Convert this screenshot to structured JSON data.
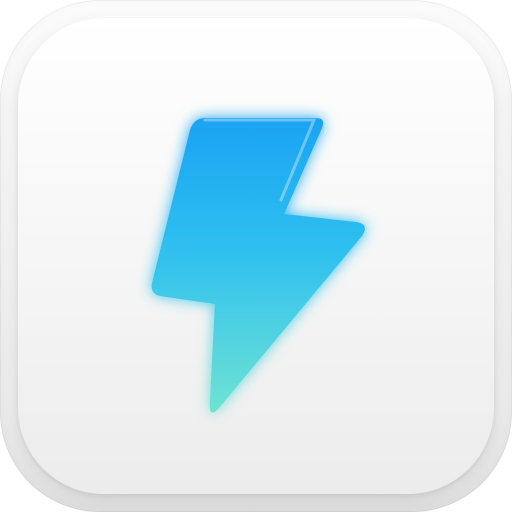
{
  "app_icon": {
    "icon": "lightning-bolt-icon",
    "colors": {
      "bolt_top": "#1aa3f2",
      "bolt_middle": "#2fc0f0",
      "bolt_bottom": "#6fe3d2",
      "glow": "#39c6ff",
      "tile_light": "#ffffff",
      "tile_shadow": "#e8e8e8"
    }
  }
}
